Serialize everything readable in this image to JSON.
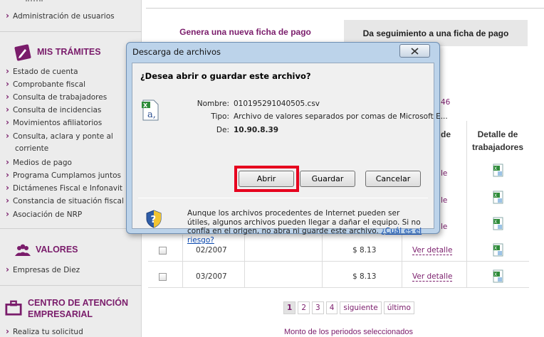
{
  "sidebar": {
    "top_item": "Administración de usuarios",
    "sections": [
      {
        "title": "MIS TRÁMITES",
        "icon": "pencil-icon",
        "items": [
          "Estado de cuenta",
          "Comprobante fiscal",
          "Consulta de trabajadores",
          "Consulta de incidencias",
          "Movimientos afiliatorios",
          "Consulta, aclara y ponte al corriente",
          "Medios de pago",
          "Programa Cumplamos juntos",
          "Dictámenes Fiscal e Infonavit",
          "Constancia de situación fiscal",
          "Asociación de NRP"
        ]
      },
      {
        "title": "VALORES",
        "icon": "people-icon",
        "items": [
          "Empresas de Diez"
        ]
      },
      {
        "title": "CENTRO DE ATENCIÓN EMPRESARIAL",
        "title_line1": "CENTRO DE ATENCIÓN",
        "title_line2": "EMPRESARIAL",
        "icon": "briefcase-icon",
        "items": [
          "Realiza tu solicitud"
        ]
      }
    ]
  },
  "tabs": [
    {
      "label": "Genera una nueva ficha de pago",
      "active": true
    },
    {
      "label": "Da seguimiento a una ficha de pago",
      "active": false
    }
  ],
  "table": {
    "partial_head": "de",
    "detalle_head_line1": "Detalle de",
    "detalle_head_line2": "trabajadores",
    "partial_number": "46",
    "rows": [
      {
        "period": "02/2007",
        "amount": "$ 8.13",
        "link": "Ver detalle"
      },
      {
        "period": "03/2007",
        "amount": "$ 8.13",
        "link": "Ver detalle"
      }
    ],
    "hidden_row_link_stub": "le",
    "xls_icon": "excel-file-icon"
  },
  "pager": {
    "pages": [
      "1",
      "2",
      "3",
      "4"
    ],
    "current": "1",
    "next_label": "siguiente",
    "last_label": "último"
  },
  "monto_label": "Monto de los periodos seleccionados",
  "dialog": {
    "title": "Descarga de archivos",
    "question": "¿Desea abrir o guardar este archivo?",
    "name_label": "Nombre:",
    "name_value": "010195291040505.csv",
    "type_label": "Tipo:",
    "type_value": "Archivo de valores separados por comas de Microsoft E...",
    "from_label": "De:",
    "from_value": "10.90.8.39",
    "buttons": {
      "open": "Abrir",
      "save": "Guardar",
      "cancel": "Cancelar"
    },
    "warning_text": "Aunque los archivos procedentes de Internet pueden ser útiles, algunos archivos pueden llegar a dañar el equipo. Si no confía en el origen, no abra ni guarde este archivo.",
    "warning_link": "¿Cuál es el riesgo?",
    "file_icon": "csv-file-icon",
    "shield_icon": "shield-question-icon",
    "highlight_color": "#e6001e"
  },
  "colors": {
    "brand": "#7a1c6b",
    "sidebar_bg": "#ececec",
    "dialog_frame": "#bcd3ea"
  }
}
